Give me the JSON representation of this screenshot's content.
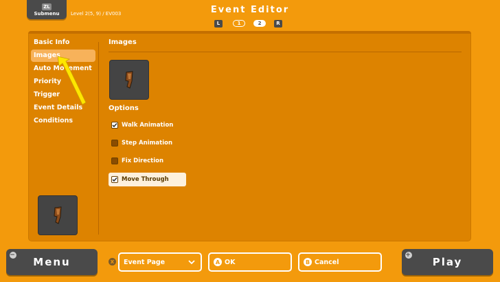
{
  "header": {
    "submenu": {
      "badge": "ZL",
      "label": "Submenu"
    },
    "location": "Level 2(5, 9) / EV003",
    "title": "Event Editor",
    "pager": {
      "left": "L",
      "page1": "1",
      "page2": "2",
      "right": "R",
      "active_page": "2"
    }
  },
  "sidebar": {
    "items": [
      {
        "label": "Basic Info",
        "active": false
      },
      {
        "label": "Images",
        "active": true
      },
      {
        "label": "Auto Movement",
        "active": false
      },
      {
        "label": "Priority",
        "active": false
      },
      {
        "label": "Trigger",
        "active": false
      },
      {
        "label": "Event Details",
        "active": false
      },
      {
        "label": "Conditions",
        "active": false
      }
    ]
  },
  "main": {
    "section_title": "Images",
    "options_title": "Options",
    "options": [
      {
        "label": "Walk Animation",
        "checked": true,
        "highlighted": false
      },
      {
        "label": "Step Animation",
        "checked": false,
        "highlighted": false
      },
      {
        "label": "Fix Direction",
        "checked": false,
        "highlighted": false
      },
      {
        "label": "Move Through",
        "checked": true,
        "highlighted": true
      }
    ]
  },
  "footer": {
    "menu": {
      "label": "Menu",
      "corner": "−"
    },
    "x_badge": "X",
    "dropdown": {
      "value": "Event Page"
    },
    "ok": {
      "badge": "A",
      "label": "OK"
    },
    "cancel": {
      "badge": "B",
      "label": "Cancel"
    },
    "play": {
      "label": "Play",
      "corner": "+"
    }
  },
  "colors": {
    "background": "#f39a0c",
    "panel": "#dd8300",
    "dark_button": "#4a4a4a",
    "highlight": "#fdf0dc"
  }
}
